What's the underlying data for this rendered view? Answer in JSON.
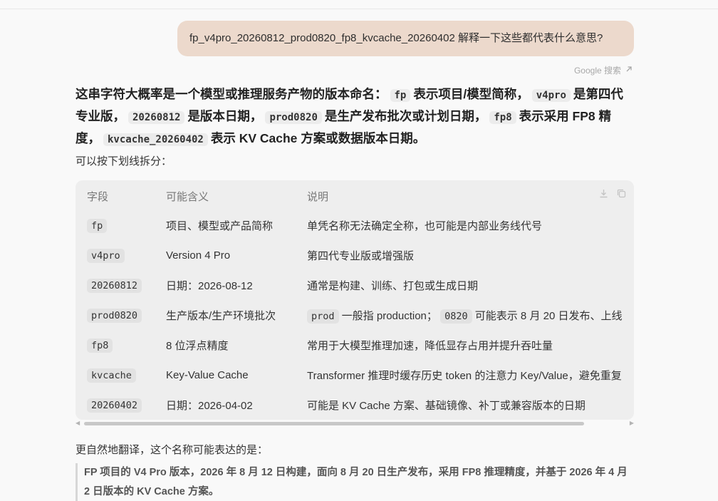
{
  "user_message": "fp_v4pro_20260812_prod0820_fp8_kvcache_20260402 解释一下这些都代表什么意思?",
  "google_search_label": "Google 搜索",
  "answer": {
    "lead_segments": [
      {
        "text": "这串字符大概率是一个模型或推理服务产物的版本命名：",
        "code": false
      },
      {
        "text": "fp",
        "code": true
      },
      {
        "text": "表示项目/模型简称，",
        "code": false
      },
      {
        "text": "v4pro",
        "code": true
      },
      {
        "text": "是第四代专业版，",
        "code": false
      },
      {
        "text": "20260812",
        "code": true
      },
      {
        "text": "是版本日期，",
        "code": false
      },
      {
        "text": "prod0820",
        "code": true
      },
      {
        "text": "是生产发布批次或计划日期，",
        "code": false
      },
      {
        "text": "fp8",
        "code": true
      },
      {
        "text": "表示采用 FP8 精度，",
        "code": false
      },
      {
        "text": "kvcache_20260402",
        "code": true
      },
      {
        "text": "表示 KV Cache 方案或数据版本日期。",
        "code": false
      }
    ],
    "split_note": "可以按下划线拆分：",
    "table": {
      "headers": [
        "字段",
        "可能含义",
        "说明"
      ],
      "rows": [
        {
          "field": "fp",
          "meaning": "项目、模型或产品简称",
          "note": [
            {
              "text": "单凭名称无法确定全称，也可能是内部业务线代号",
              "code": false
            }
          ]
        },
        {
          "field": "v4pro",
          "meaning": "Version 4 Pro",
          "note": [
            {
              "text": "第四代专业版或增强版",
              "code": false
            }
          ]
        },
        {
          "field": "20260812",
          "meaning": "日期：2026-08-12",
          "note": [
            {
              "text": "通常是构建、训练、打包或生成日期",
              "code": false
            }
          ]
        },
        {
          "field": "prod0820",
          "meaning": "生产版本/生产环境批次",
          "note": [
            {
              "text": "prod",
              "code": true
            },
            {
              "text": " 一般指 production； ",
              "code": false
            },
            {
              "text": "0820",
              "code": true
            },
            {
              "text": " 可能表示 8 月 20 日发布、上线",
              "code": false
            }
          ]
        },
        {
          "field": "fp8",
          "meaning": "8 位浮点精度",
          "note": [
            {
              "text": "常用于大模型推理加速，降低显存占用并提升吞吐量",
              "code": false
            }
          ]
        },
        {
          "field": "kvcache",
          "meaning": "Key-Value Cache",
          "note": [
            {
              "text": "Transformer 推理时缓存历史 token 的注意力 Key/Value，避免重复",
              "code": false
            }
          ]
        },
        {
          "field": "20260402",
          "meaning": "日期：2026-04-02",
          "note": [
            {
              "text": "可能是 KV Cache 方案、基础镜像、补丁或兼容版本的日期",
              "code": false
            }
          ]
        }
      ]
    },
    "natural_translation_label": "更自然地翻译，这个名称可能表达的是：",
    "quote_text": "FP 项目的 V4 Pro 版本，2026 年 8 月 12 日构建，面向 8 月 20 日生产发布，采用 FP8 推理精度，并基于 2026 年 4 月 2 日版本的 KV Cache 方案。"
  },
  "icons": {
    "google_search": "arrow-up-right-icon",
    "table_download": "download-icon",
    "table_copy": "copy-icon"
  }
}
